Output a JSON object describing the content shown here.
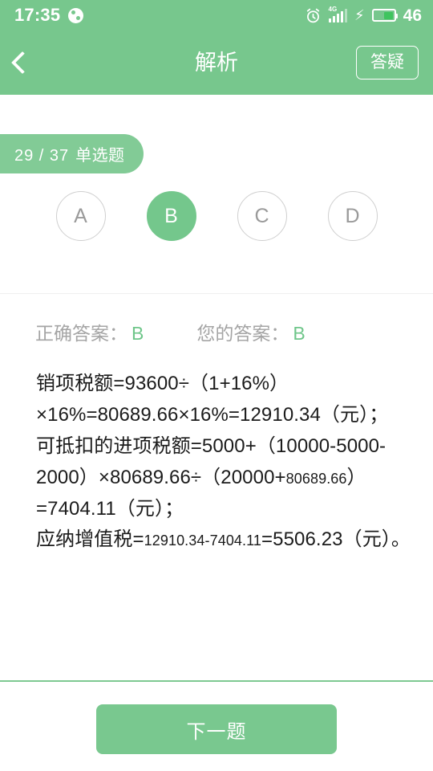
{
  "status_bar": {
    "time": "17:35",
    "weather_icon": "circle-split-icon",
    "alarm_icon": "alarm-clock-icon",
    "network_label": "4G",
    "signal_icon": "signal-bars-icon",
    "charging_icon": "lightning-bolt-icon",
    "battery_icon": "battery-icon",
    "battery_percent": "46"
  },
  "nav": {
    "back_icon": "chevron-left-icon",
    "title": "解析",
    "ask_label": "答疑"
  },
  "question": {
    "badge_progress": "29 / 37",
    "badge_type": "单选题",
    "options": [
      {
        "label": "A",
        "selected": false
      },
      {
        "label": "B",
        "selected": true
      },
      {
        "label": "C",
        "selected": false
      },
      {
        "label": "D",
        "selected": false
      }
    ]
  },
  "answers": {
    "correct_label": "正确答案：",
    "correct_value": "B",
    "yours_label": "您的答案：",
    "yours_value": "B"
  },
  "explanation": {
    "segments": [
      {
        "text": "销项税额=93600÷（1+16%）×16%=80689.66×16%=12910.34（元）；",
        "small": false
      },
      {
        "text": "\n",
        "small": false
      },
      {
        "text": "可抵扣的进项税额=5000+（10000-5000-2000）×80689.66÷（20000+",
        "small": false
      },
      {
        "text": "80689.66",
        "small": true
      },
      {
        "text": "）=7404.11（元）；",
        "small": false
      },
      {
        "text": "\n",
        "small": false
      },
      {
        "text": "应纳增值税=",
        "small": false
      },
      {
        "text": "12910.34-7404.11",
        "small": true
      },
      {
        "text": "=5506.23（元）。",
        "small": false
      }
    ]
  },
  "footer": {
    "next_label": "下一题"
  },
  "colors": {
    "brand_green": "#77c78d",
    "button_green": "#79c88f",
    "accent_green": "#6fc68a",
    "badge_green": "#82cb96",
    "text_dark": "#1b1b1b",
    "text_muted": "#a5a5a5",
    "option_border": "#cfcfcf"
  }
}
